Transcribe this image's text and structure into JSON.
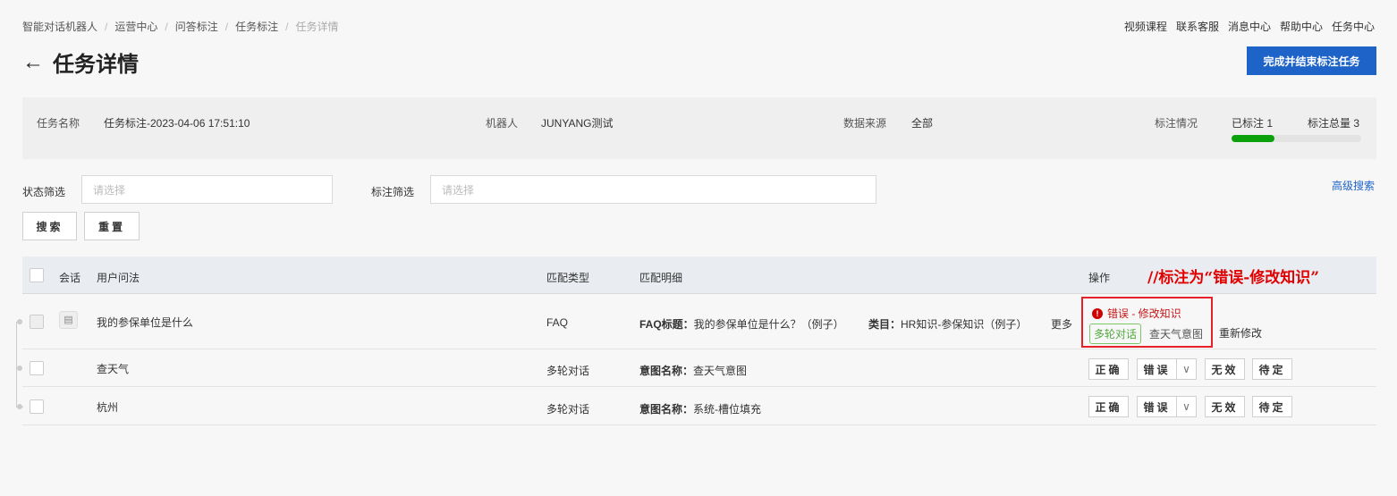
{
  "breadcrumb": [
    "智能对话机器人",
    "运营中心",
    "问答标注",
    "任务标注",
    "任务详情"
  ],
  "top_links": [
    "视频课程",
    "联系客服",
    "消息中心",
    "帮助中心",
    "任务中心"
  ],
  "title": "任务详情",
  "finish_button": "完成并结束标注任务",
  "info": {
    "task_name_label": "任务名称",
    "task_name": "任务标注-2023-04-06 17:51:10",
    "robot_label": "机器人",
    "robot": "JUNYANG测试",
    "source_label": "数据来源",
    "source": "全部",
    "status_label": "标注情况",
    "annotated": "已标注 1",
    "total": "标注总量 3",
    "progress_fraction": 0.333
  },
  "filters": {
    "status_label": "状态筛选",
    "status_placeholder": "请选择",
    "mark_label": "标注筛选",
    "mark_placeholder": "请选择",
    "advanced": "高级搜索",
    "search": "搜索",
    "reset": "重置"
  },
  "table": {
    "headers": [
      "会话",
      "用户问法",
      "匹配类型",
      "匹配明细",
      "操作"
    ],
    "annotation_note": "//标注为“错误-修改知识”",
    "rows": [
      {
        "query": "我的参保单位是什么",
        "type": "FAQ",
        "detail_label1": "FAQ标题：",
        "detail1": "我的参保单位是什么？（例子）",
        "detail_label2": "类目：",
        "detail2": "HR知识-参保知识（例子）",
        "more": "更多",
        "result": "错误 - 修改知识",
        "tag": "多轮对话",
        "intent": "查天气意图",
        "redo": "重新修改"
      },
      {
        "query": "查天气",
        "type": "多轮对话",
        "detail_label1": "意图名称：",
        "detail1": "查天气意图"
      },
      {
        "query": "杭州",
        "type": "多轮对话",
        "detail_label1": "意图名称：",
        "detail1": "系统-槽位填充"
      }
    ],
    "actions": {
      "correct": "正确",
      "wrong": "错误",
      "invalid": "无效",
      "pending": "待定"
    }
  },
  "colors": {
    "primary": "#1e63c8",
    "progress": "#0aa10a",
    "error": "#d40000"
  }
}
